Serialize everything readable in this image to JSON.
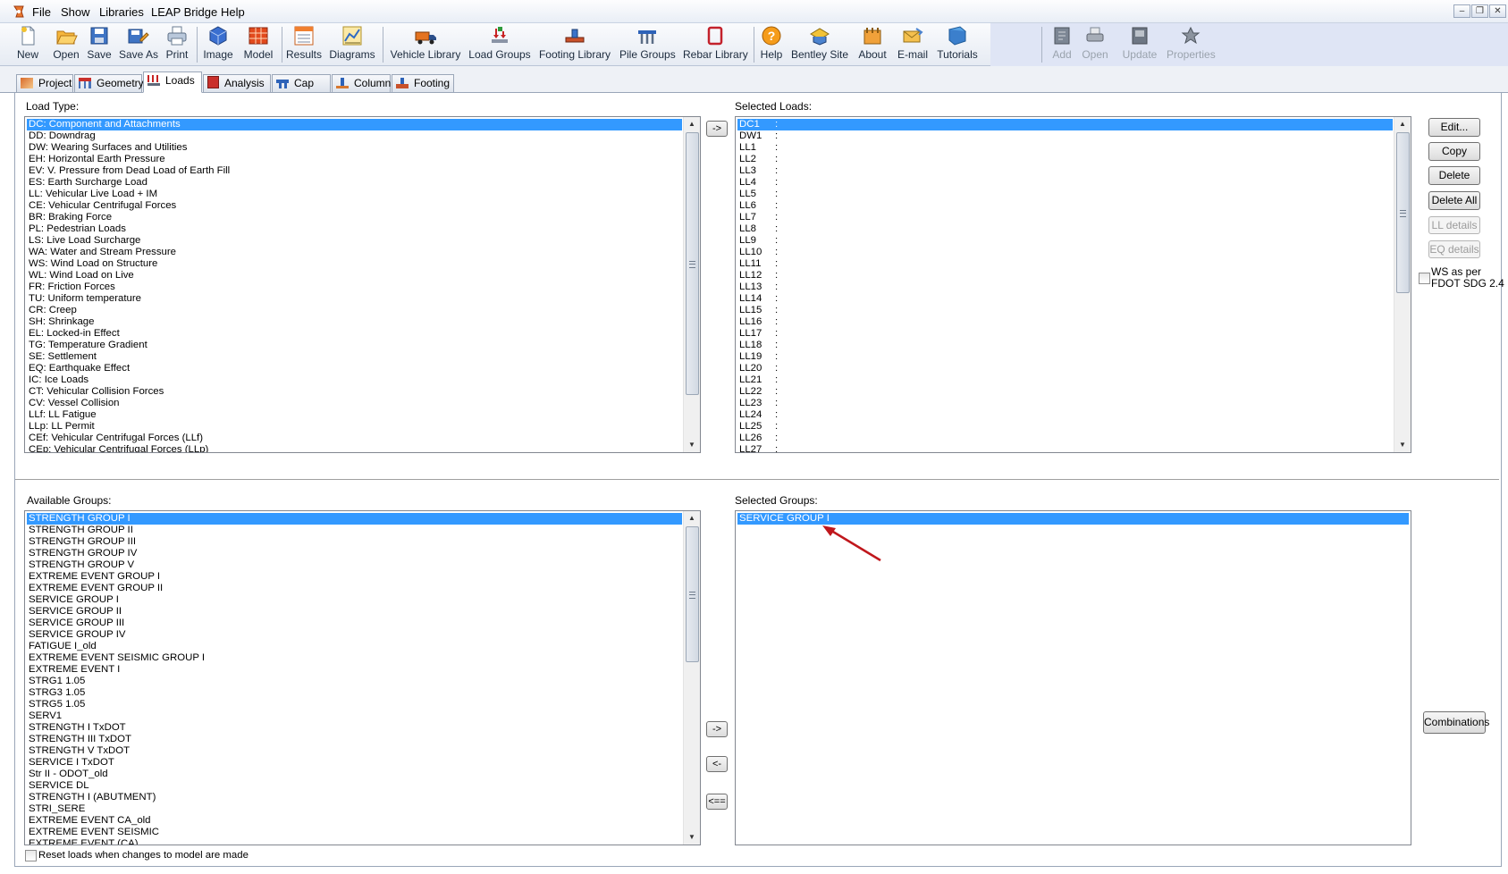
{
  "menu": [
    "File",
    "Show",
    "Libraries",
    "LEAP Bridge",
    "Help"
  ],
  "toolbar": {
    "new": "New",
    "open": "Open",
    "save": "Save",
    "save_as": "Save As",
    "print": "Print",
    "image": "Image",
    "model": "Model",
    "results": "Results",
    "diagrams": "Diagrams",
    "vehicle_library": "Vehicle Library",
    "load_groups": "Load Groups",
    "footing_library": "Footing Library",
    "pile_groups": "Pile Groups",
    "rebar_library": "Rebar Library",
    "help": "Help",
    "bentley_site": "Bentley Site",
    "about": "About",
    "email": "E-mail",
    "tutorials": "Tutorials",
    "add": "Add",
    "open2": "Open",
    "update": "Update",
    "properties": "Properties"
  },
  "tabs": [
    "Project",
    "Geometry",
    "Loads",
    "Analysis",
    "Cap",
    "Column",
    "Footing"
  ],
  "active_tab": "Loads",
  "load_type": {
    "label": "Load Type:",
    "items": [
      "DC: Component and Attachments",
      "DD: Downdrag",
      "DW: Wearing Surfaces and Utilities",
      "EH: Horizontal Earth Pressure",
      "EV: V. Pressure from Dead Load of Earth Fill",
      "ES: Earth Surcharge Load",
      "LL: Vehicular Live Load + IM",
      "CE: Vehicular Centrifugal Forces",
      "BR: Braking Force",
      "PL: Pedestrian Loads",
      "LS: Live Load Surcharge",
      "WA: Water and Stream Pressure",
      "WS: Wind Load on Structure",
      "WL: Wind Load on Live",
      "FR: Friction Forces",
      "TU: Uniform temperature",
      "CR: Creep",
      "SH: Shrinkage",
      "EL: Locked-in Effect",
      "TG: Temperature Gradient",
      "SE: Settlement",
      "EQ: Earthquake Effect",
      "IC: Ice Loads",
      "CT: Vehicular Collision Forces",
      "CV: Vessel Collision",
      "LLf: LL Fatigue",
      "LLp: LL Permit",
      "CEf: Vehicular Centrifugal Forces (LLf)",
      "CEp: Vehicular Centrifugal Forces (LLp)"
    ],
    "selected_index": 0
  },
  "add_load_button": "->",
  "selected_loads": {
    "label": "Selected Loads:",
    "items": [
      "DC1",
      "DW1",
      "LL1",
      "LL2",
      "LL3",
      "LL4",
      "LL5",
      "LL6",
      "LL7",
      "LL8",
      "LL9",
      "LL10",
      "LL11",
      "LL12",
      "LL13",
      "LL14",
      "LL15",
      "LL16",
      "LL17",
      "LL18",
      "LL19",
      "LL20",
      "LL21",
      "LL22",
      "LL23",
      "LL24",
      "LL25",
      "LL26",
      "LL27"
    ],
    "separator": ":",
    "selected_index": 0
  },
  "side_buttons": {
    "edit": "Edit...",
    "copy": "Copy",
    "delete": "Delete",
    "delete_all": "Delete All",
    "ll_details": "LL details",
    "eq_details": "EQ details",
    "ws_checkbox_line1": "WS as per",
    "ws_checkbox_line2": "FDOT SDG 2.4",
    "combinations": "Combinations"
  },
  "available_groups": {
    "label": "Available Groups:",
    "items": [
      "STRENGTH GROUP I",
      "STRENGTH GROUP II",
      "STRENGTH GROUP III",
      "STRENGTH GROUP IV",
      "STRENGTH GROUP V",
      "EXTREME EVENT GROUP I",
      "EXTREME EVENT GROUP II",
      "SERVICE GROUP I",
      "SERVICE GROUP II",
      "SERVICE GROUP III",
      "SERVICE GROUP IV",
      "FATIGUE I_old",
      "EXTREME EVENT SEISMIC GROUP I",
      "EXTREME EVENT I",
      "STRG1 1.05",
      "STRG3 1.05",
      "STRG5 1.05",
      "SERV1",
      "STRENGTH I TxDOT",
      "STRENGTH III TxDOT",
      "STRENGTH V TxDOT",
      "SERVICE I TxDOT",
      "Str II - ODOT_old",
      "SERVICE DL",
      "STRENGTH I (ABUTMENT)",
      "STRI_SERE",
      "EXTREME EVENT CA_old",
      "EXTREME EVENT SEISMIC",
      "EXTREME EVENT (CA)"
    ],
    "selected_index": 0
  },
  "group_buttons": {
    "add": "->",
    "remove": "<-",
    "remove_all": "<=="
  },
  "selected_groups": {
    "label": "Selected Groups:",
    "items": [
      "SERVICE GROUP I"
    ],
    "selected_index": 0
  },
  "reset_checkbox_label": "Reset loads when changes to model are made",
  "colors": {
    "selection": "#3399ff",
    "annotation_arrow": "#c0171c"
  }
}
